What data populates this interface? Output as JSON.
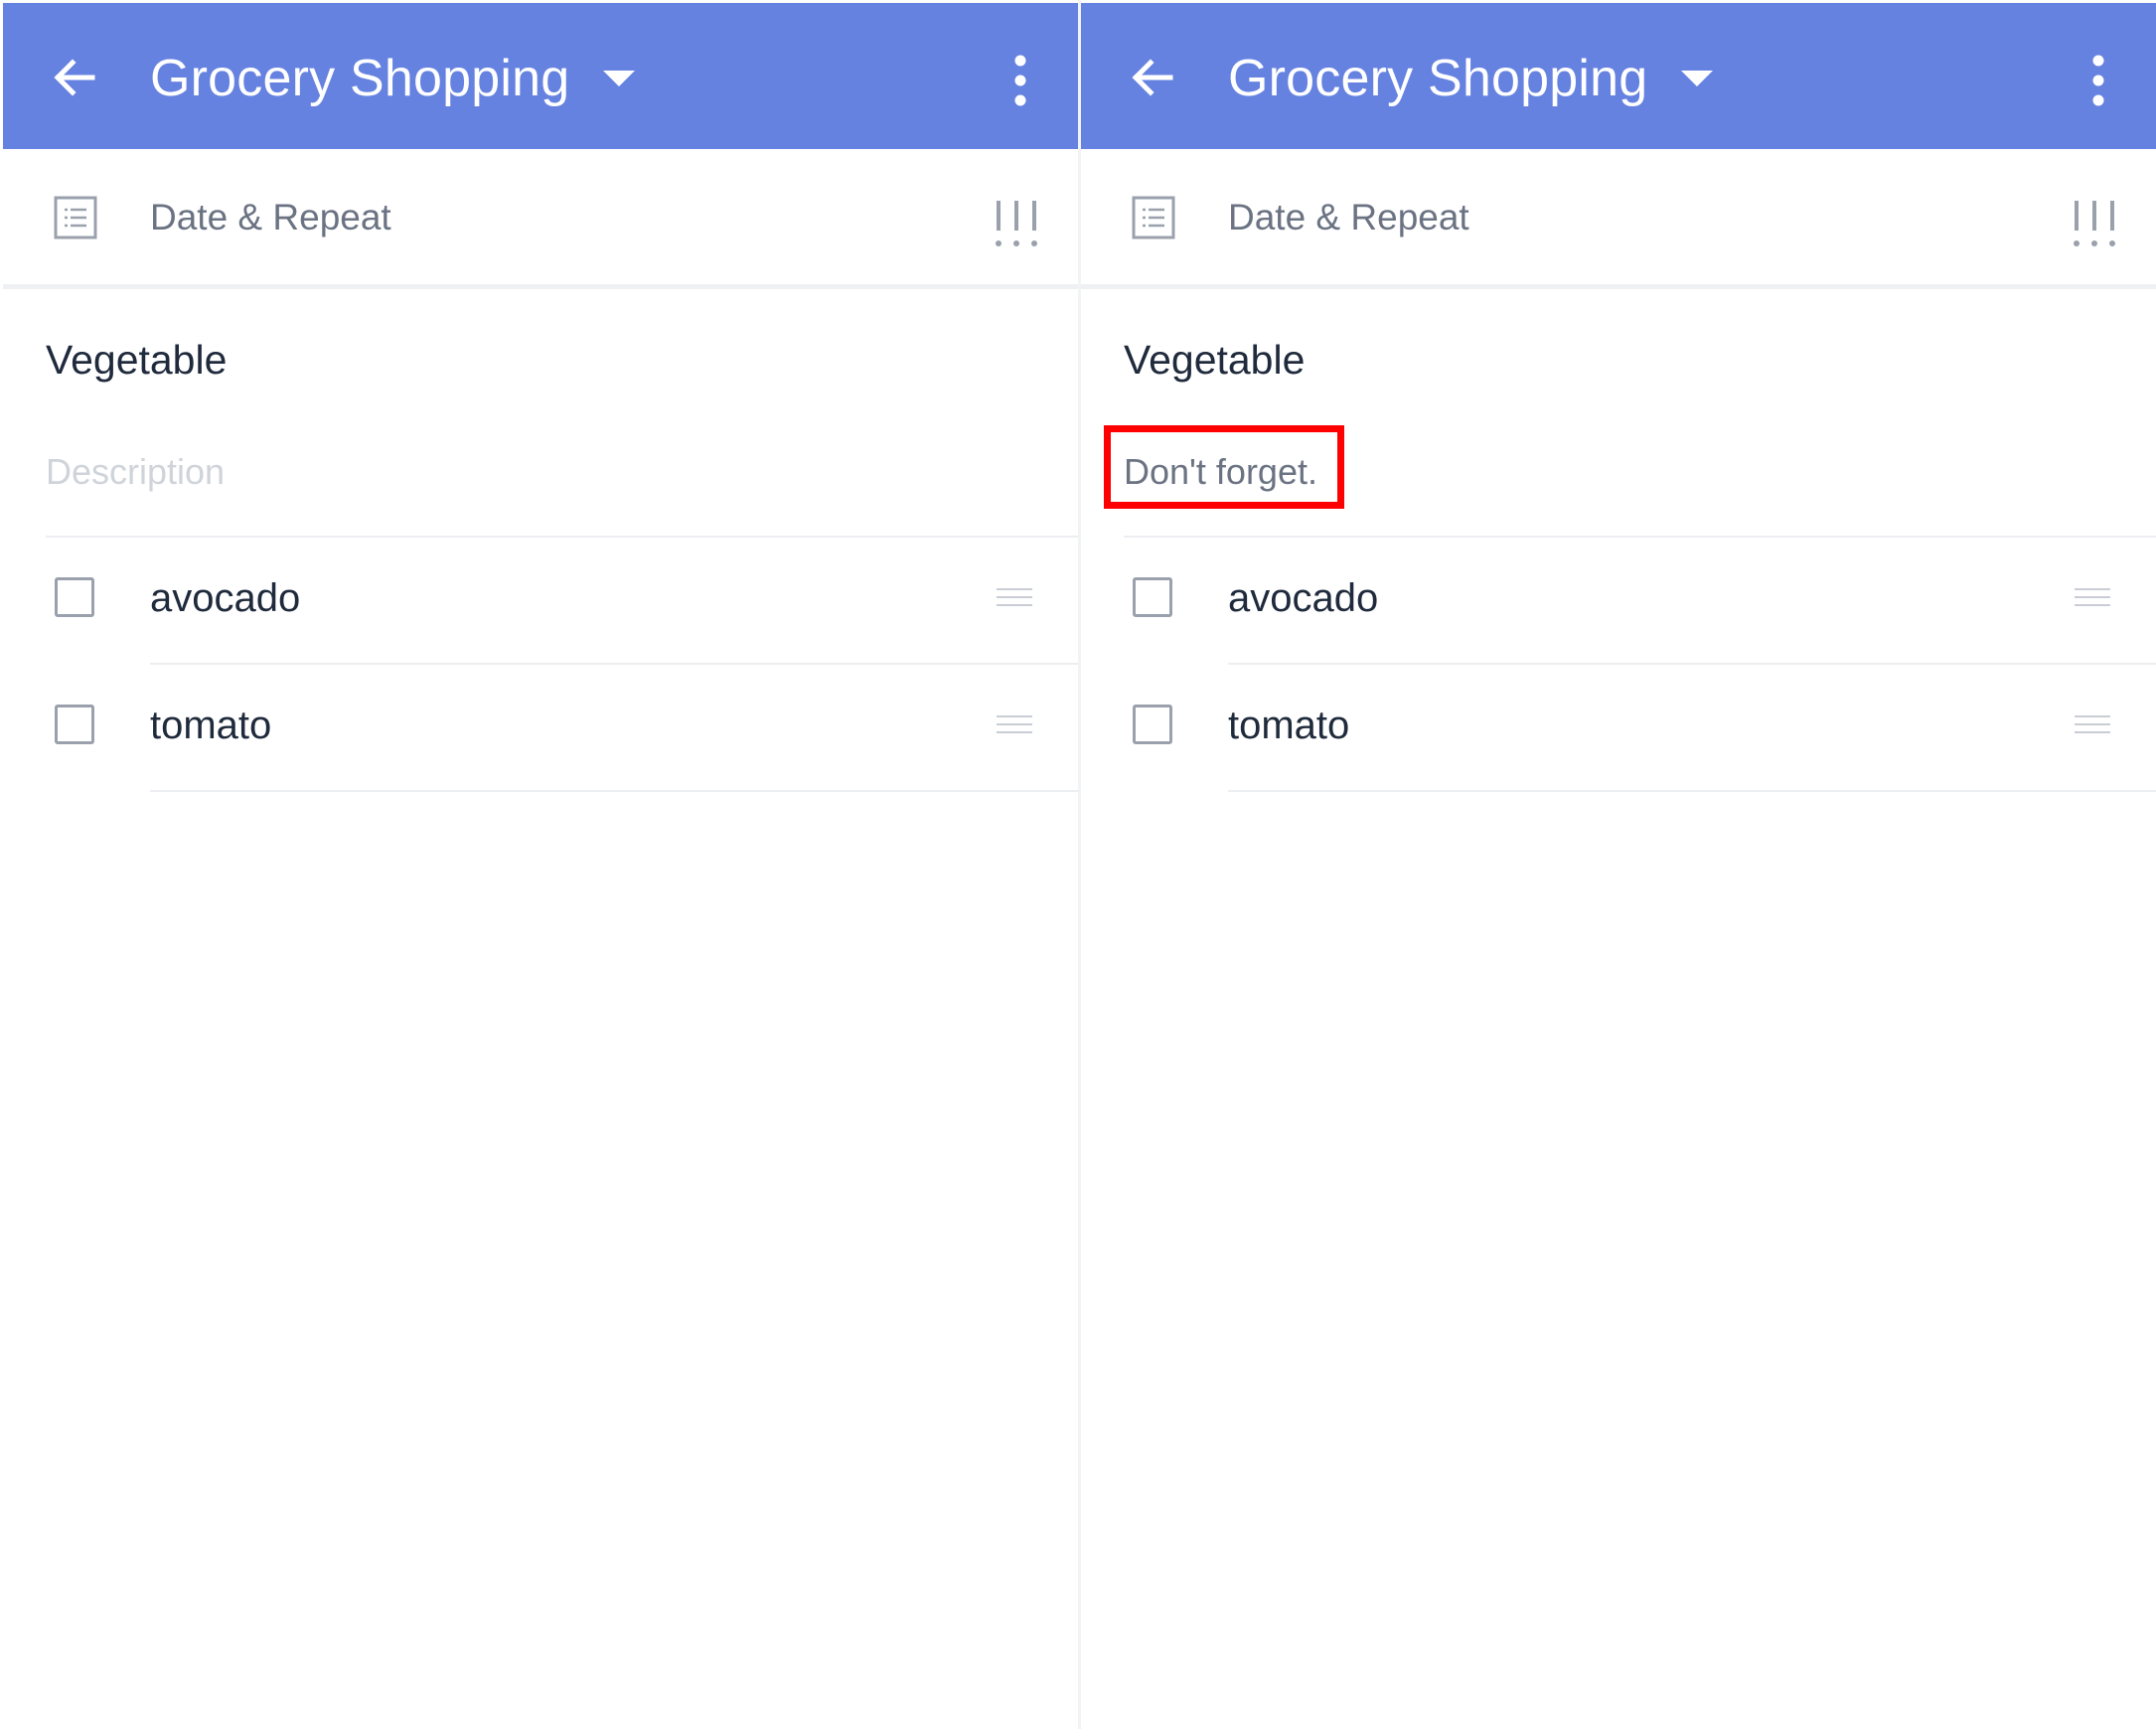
{
  "colors": {
    "appbar": "#6682e0",
    "highlight": "#ff0000",
    "text_primary": "#1f2a3c",
    "text_secondary": "#6b7383",
    "placeholder": "#cfd3da"
  },
  "panels": [
    {
      "appbar": {
        "title": "Grocery Shopping",
        "icons": [
          "back-arrow-icon",
          "caret-down-icon",
          "more-vertical-icon"
        ]
      },
      "date_row": {
        "label": "Date & Repeat",
        "icons": [
          "notes-icon",
          "priority-icon"
        ]
      },
      "list": {
        "title": "Vegetable",
        "description_placeholder": "Description",
        "description_value": ""
      },
      "items": [
        {
          "label": "avocado",
          "checked": false
        },
        {
          "label": "tomato",
          "checked": false
        }
      ]
    },
    {
      "appbar": {
        "title": "Grocery Shopping",
        "icons": [
          "back-arrow-icon",
          "caret-down-icon",
          "more-vertical-icon"
        ]
      },
      "date_row": {
        "label": "Date & Repeat",
        "icons": [
          "notes-icon",
          "priority-icon"
        ]
      },
      "list": {
        "title": "Vegetable",
        "description_placeholder": "",
        "description_value": "Don't forget."
      },
      "items": [
        {
          "label": "avocado",
          "checked": false
        },
        {
          "label": "tomato",
          "checked": false
        }
      ]
    }
  ]
}
